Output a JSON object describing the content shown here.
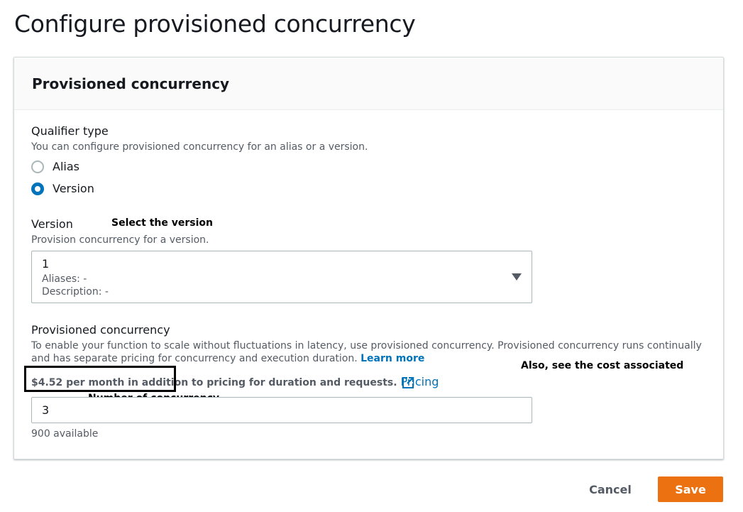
{
  "page": {
    "title": "Configure provisioned concurrency"
  },
  "panel": {
    "title": "Provisioned concurrency"
  },
  "qualifier": {
    "label": "Qualifier type",
    "description": "You can configure provisioned concurrency for an alias or a version.",
    "options": [
      {
        "label": "Alias",
        "checked": false
      },
      {
        "label": "Version",
        "checked": true
      }
    ]
  },
  "version": {
    "label": "Version",
    "description": "Provision concurrency for a version.",
    "selected_value": "1",
    "aliases": "Aliases: -",
    "description_line": "Description: -"
  },
  "concurrency": {
    "label": "Provisioned concurrency",
    "description": "To enable your function to scale without fluctuations in latency, use provisioned concurrency. Provisioned concurrency runs continually and has separate pricing for concurrency and execution duration.",
    "learn_more": "Learn more",
    "cost_highlight": "$4.52 per month in addition",
    "cost_rest": " to pricing for duration and requests.",
    "pricing_link": "Pricing",
    "value": "3",
    "available": "900 available"
  },
  "annotations": {
    "select_version": "Select the version",
    "see_cost": "Also, see the cost associated",
    "number_of_concurrency": "Number of concurrency"
  },
  "actions": {
    "cancel": "Cancel",
    "save": "Save"
  },
  "colors": {
    "accent": "#0073bb",
    "primary_button": "#ec7211",
    "text_secondary": "#545b64"
  }
}
